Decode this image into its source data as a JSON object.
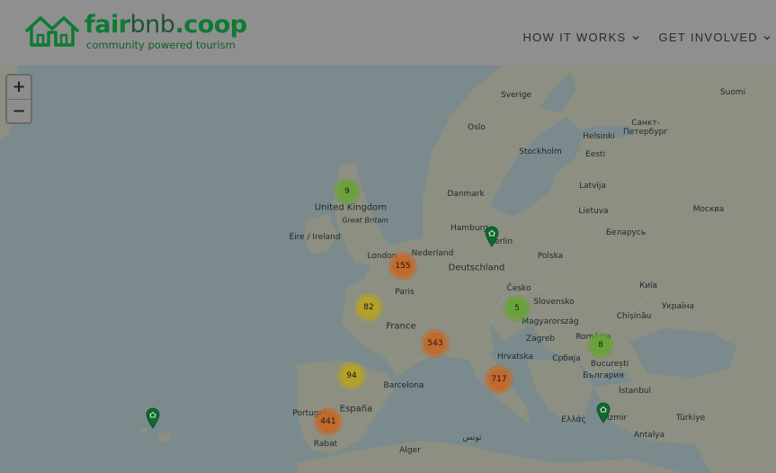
{
  "header": {
    "logo": {
      "part1": "fair",
      "part2": "bnb",
      "part3": ".coop",
      "tagline": "community powered tourism"
    },
    "nav": [
      {
        "label": "HOW IT WORKS"
      },
      {
        "label": "GET INVOLVED"
      }
    ]
  },
  "zoom": {
    "in": "+",
    "out": "−"
  },
  "colors": {
    "brand_green": "#0e7a33",
    "cluster_green": "#6aa23a",
    "cluster_yellow": "#b4a12a",
    "cluster_orange": "#c2692c",
    "sea": "#7a8a8d",
    "land": "#8c8f82"
  },
  "map": {
    "labels": [
      "Sverige",
      "Oslo",
      "Stockholm",
      "Санкт-Петербург",
      "Helsinki",
      "Eesti",
      "Latvija",
      "Danmark",
      "Lietuva",
      "Москва",
      "United Kingdom",
      "Great Britain",
      "Éire / Ireland",
      "Hamburg",
      "Berlin",
      "Беларусь",
      "Nederland",
      "London",
      "Deutschland",
      "Polska",
      "Paris",
      "Česko",
      "Київ",
      "Slovensko",
      "Україна",
      "Chișinău",
      "France",
      "Magyarország",
      "Zagreb",
      "România",
      "Hrvatska",
      "Србија",
      "București",
      "България",
      "Barcelona",
      "İstanbul",
      "España",
      "Portugal",
      "Ελλάς",
      "İzmir",
      "Türkiye",
      "Antalya",
      "Rabat",
      "Alger",
      "تونس",
      "Suomi"
    ],
    "clusters": [
      {
        "count": "9",
        "color": "green"
      },
      {
        "count": "155",
        "color": "orange"
      },
      {
        "count": "82",
        "color": "yellow"
      },
      {
        "count": "543",
        "color": "orange"
      },
      {
        "count": "5",
        "color": "green"
      },
      {
        "count": "8",
        "color": "green"
      },
      {
        "count": "717",
        "color": "orange"
      },
      {
        "count": "94",
        "color": "yellow"
      },
      {
        "count": "441",
        "color": "orange"
      }
    ],
    "pins": [
      "berlin-pin",
      "azores-pin",
      "izmir-pin"
    ]
  }
}
